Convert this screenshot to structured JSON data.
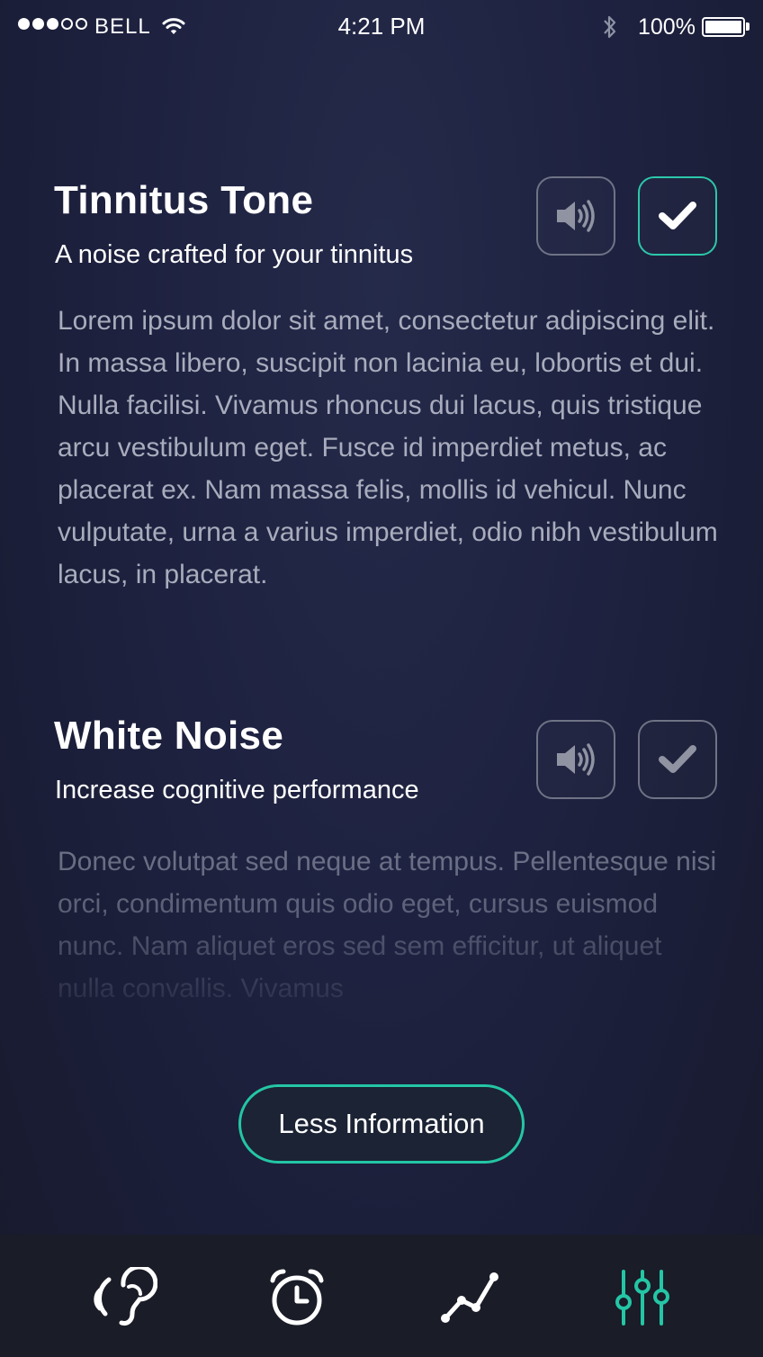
{
  "status_bar": {
    "carrier": "BELL",
    "time": "4:21 PM",
    "battery": "100%"
  },
  "sections": [
    {
      "title": "Tinnitus Tone",
      "subtitle": "A noise crafted for your tinnitus",
      "description": "Lorem ipsum dolor sit amet, consectetur adipiscing elit. In massa libero, suscipit non lacinia eu, lobortis et dui. Nulla facilisi. Vivamus rhoncus dui lacus, quis tristique arcu vestibulum eget. Fusce id imperdiet metus, ac placerat ex. Nam massa felis, mollis id vehicul. Nunc vulputate, urna a varius imperdiet, odio nibh vestibulum lacus, in placerat.",
      "selected": true
    },
    {
      "title": "White Noise",
      "subtitle": "Increase cognitive performance",
      "description": "Donec volutpat sed neque at tempus. Pellentesque nisi orci, condimentum quis odio eget, cursus euismod nunc. Nam aliquet eros sed sem efficitur, ut aliquet nulla convallis. Vivamus",
      "selected": false
    }
  ],
  "less_button": "Less Information",
  "tabs": [
    {
      "icon": "ear-icon",
      "active": false
    },
    {
      "icon": "alarm-clock-icon",
      "active": false
    },
    {
      "icon": "chart-line-icon",
      "active": false
    },
    {
      "icon": "sliders-icon",
      "active": true
    }
  ],
  "colors": {
    "accent": "#2cc7aa",
    "background": "#1e2240",
    "muted_text": "#a8acbc"
  }
}
